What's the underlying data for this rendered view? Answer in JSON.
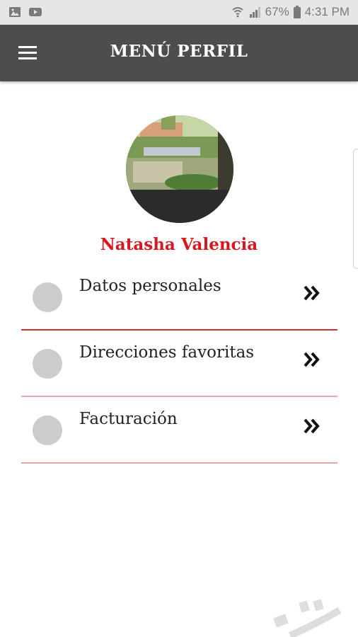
{
  "status_bar": {
    "battery_percent": "67%",
    "time": "4:31 PM",
    "icons_left": [
      "image-icon",
      "youtube-icon"
    ],
    "icons_right": [
      "wifi-icon",
      "signal-icon",
      "battery-icon"
    ]
  },
  "app_bar": {
    "title": "MENÚ PERFIL",
    "menu_icon": "hamburger-icon",
    "background": "#4d4d4d"
  },
  "profile": {
    "name": "Natasha Valencia",
    "name_color": "#d7191f"
  },
  "menu": {
    "items": [
      {
        "label": "Datos personales",
        "icon": "double-chevron-right-icon",
        "divider_color": "#d32f2f"
      },
      {
        "label": "Direcciones favoritas",
        "icon": "double-chevron-right-icon",
        "divider_color": "#e6a6a6"
      },
      {
        "label": "Facturación",
        "icon": "double-chevron-right-icon",
        "divider_color": "#e6a6a6"
      }
    ]
  }
}
